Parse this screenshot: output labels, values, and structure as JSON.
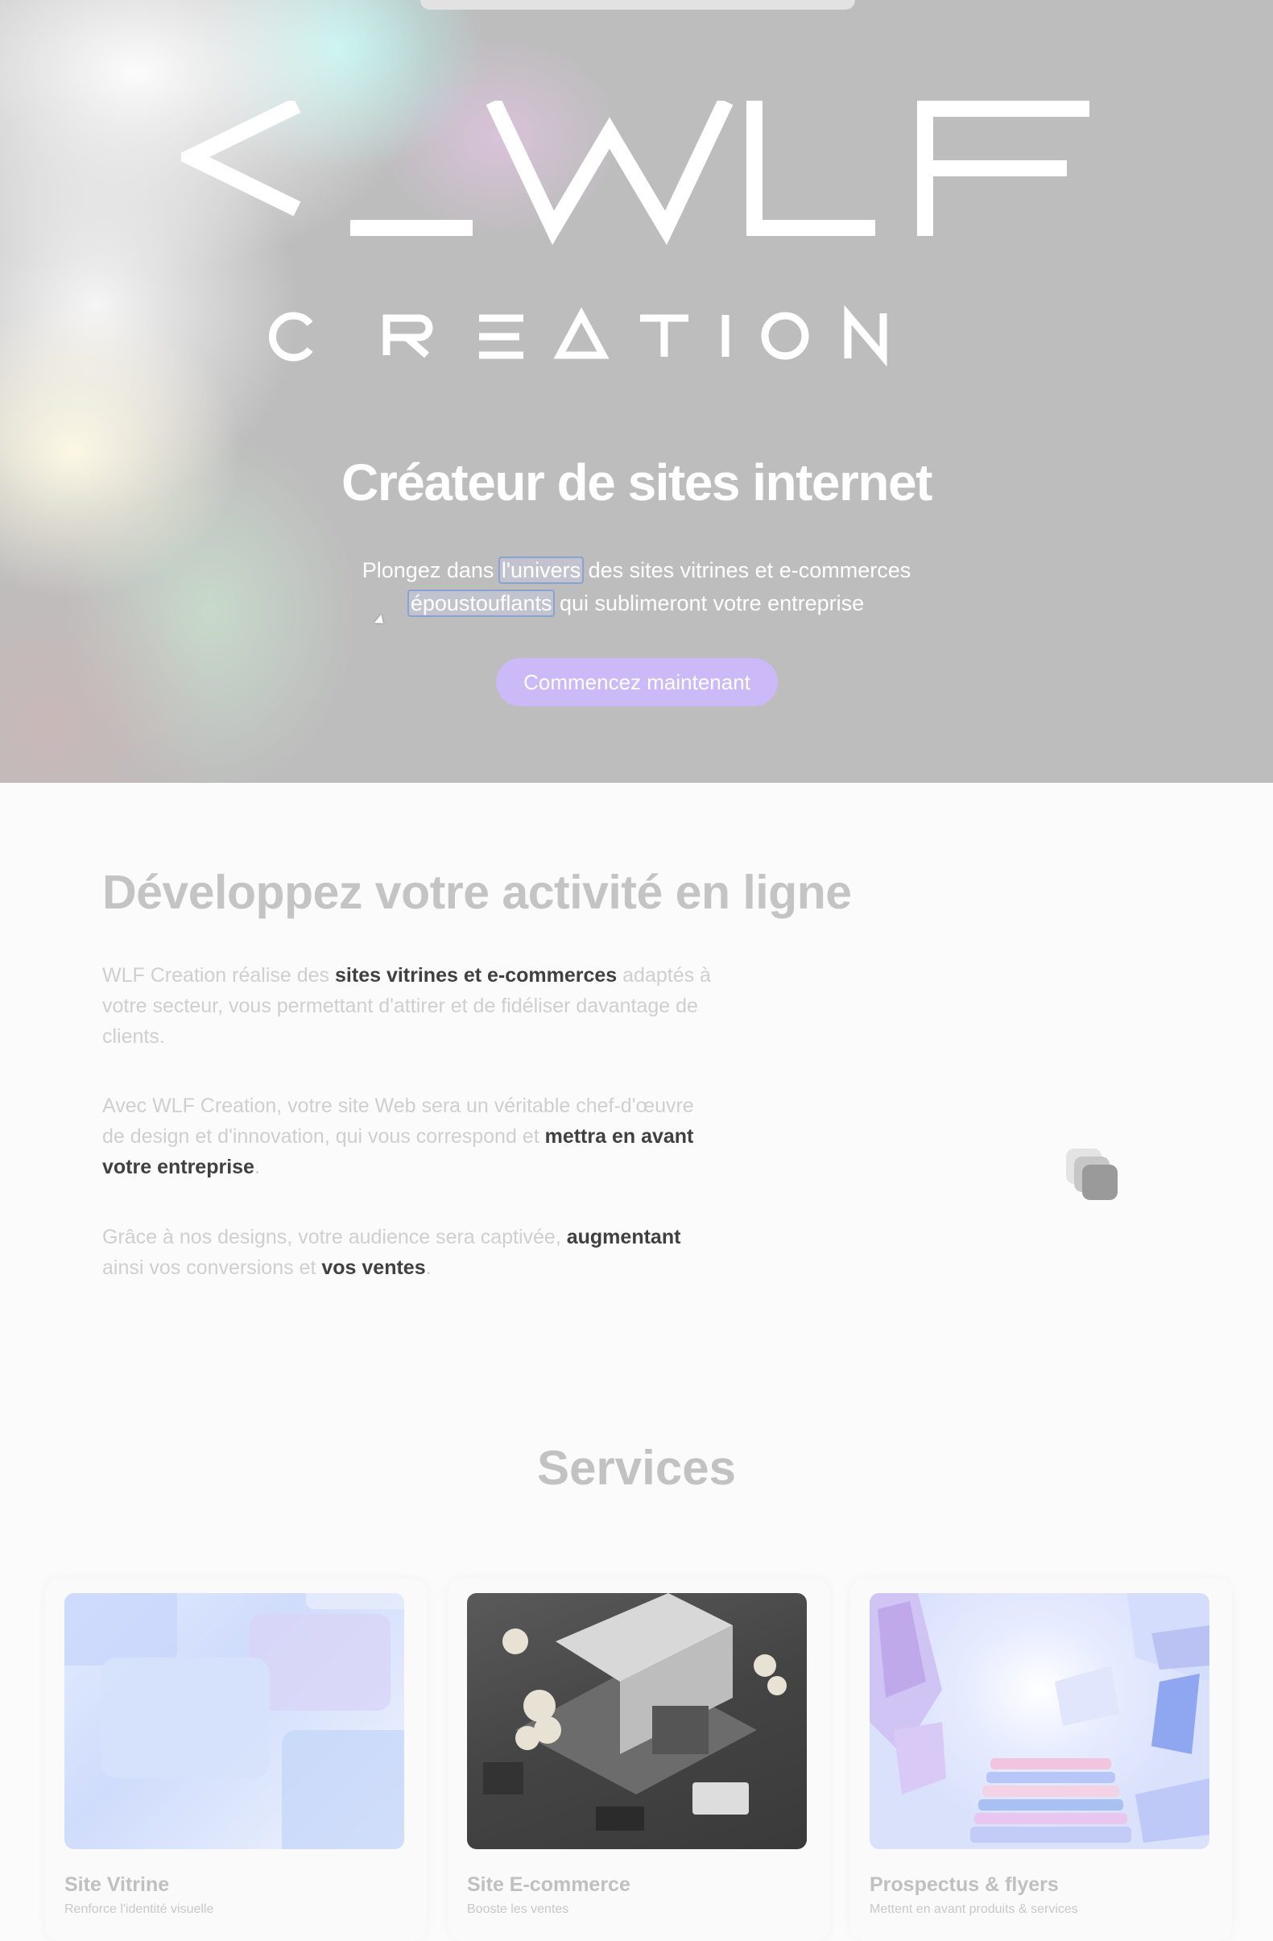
{
  "hero": {
    "logo_line1": "<_WLF",
    "logo_line2": "CREATION",
    "title": "Créateur de sites internet",
    "subtitle_part1": "Plongez dans ",
    "subtitle_sel1": "l'univers",
    "subtitle_part2": " des sites vitrines et e-commerces",
    "subtitle_sel2": "époustouflants",
    "subtitle_part3": " qui sublimeront votre entreprise",
    "cta_label": "Commencez maintenant"
  },
  "about": {
    "title": "Développez votre activité en ligne",
    "p1": [
      "WLF Creation réalise des ",
      "sites vitrines et e-commerces",
      " adaptés à votre secteur, vous permettant d'attirer et de fidéliser davantage de clients."
    ],
    "p2": [
      "Avec WLF Creation, votre site Web sera un véritable chef-d'œuvre de design et d'innovation, qui vous correspond et ",
      "mettra en avant votre entreprise",
      "."
    ],
    "p3": [
      "Grâce à nos designs, votre audience sera captivée, ",
      "augmentant",
      " ainsi vos conversions et ",
      "vos ventes",
      "."
    ]
  },
  "services": {
    "title": "Services",
    "cards": [
      {
        "title": "Site Vitrine",
        "desc": "Renforce l'identité visuelle"
      },
      {
        "title": "Site E-commerce",
        "desc": "Booste les ventes"
      },
      {
        "title": "Prospectus & flyers",
        "desc": "Mettent en avant produits & services"
      }
    ]
  },
  "colors": {
    "hero_bg": "#bdbdbd",
    "cta_bg": "#cbb9f8",
    "page_bg": "#fbfbfb"
  }
}
